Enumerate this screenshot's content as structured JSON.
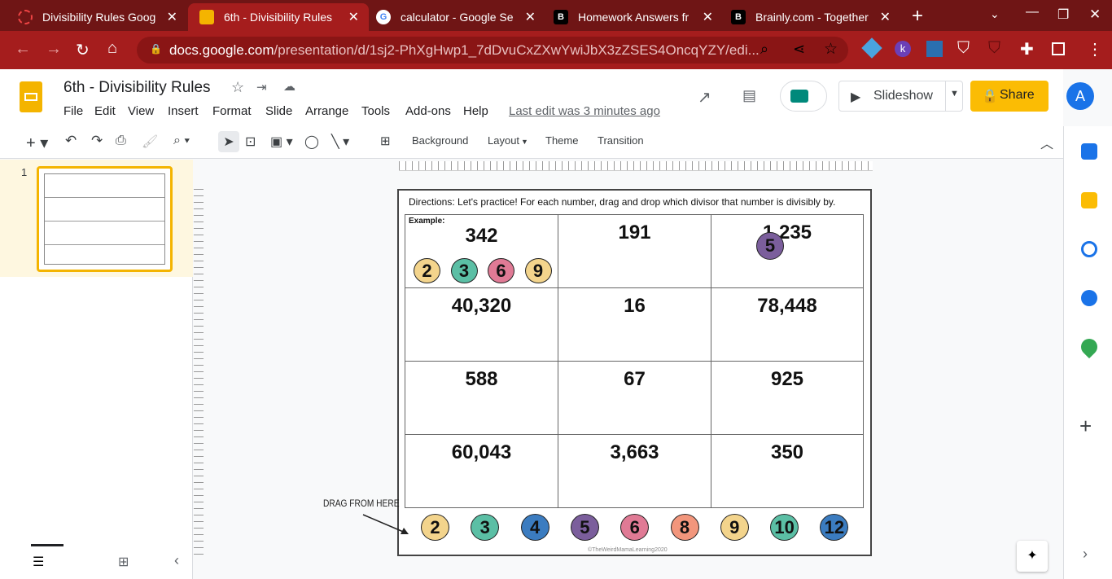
{
  "browser": {
    "tabs": [
      {
        "label": "Divisibility Rules Goog",
        "icon": "loading-icon"
      },
      {
        "label": "6th - Divisibility Rules",
        "icon": "slides-icon",
        "active": true
      },
      {
        "label": "calculator - Google Se",
        "icon": "google-icon"
      },
      {
        "label": "Homework Answers fr",
        "icon": "brainly-icon"
      },
      {
        "label": "Brainly.com - Together",
        "icon": "brainly-icon"
      }
    ],
    "url_host": "docs.google.com",
    "url_path": "/presentation/d/1sj2-PhXgHwp1_7dDvuCxZXwYwiJbX3zZSES4OncqYZY/edi..."
  },
  "doc": {
    "title": "6th - Divisibility Rules",
    "menu": [
      "File",
      "Edit",
      "View",
      "Insert",
      "Format",
      "Slide",
      "Arrange",
      "Tools",
      "Add-ons",
      "Help"
    ],
    "last_edit": "Last edit was 3 minutes ago",
    "slideshow": "Slideshow",
    "share": "Share",
    "avatar": "A"
  },
  "toolbar": {
    "background": "Background",
    "layout": "Layout",
    "theme": "Theme",
    "transition": "Transition"
  },
  "filmstrip": {
    "slide_number": "1"
  },
  "slide": {
    "directions": "Directions: Let's practice! For each number, drag and drop which divisor that number is divisibly by.",
    "example_label": "Example:",
    "numbers": [
      "342",
      "191",
      "1,235",
      "40,320",
      "16",
      "78,448",
      "588",
      "67",
      "925",
      "60,043",
      "3,663",
      "350"
    ],
    "example_chips": [
      {
        "n": "2",
        "color": "#f3d48c"
      },
      {
        "n": "3",
        "color": "#5bbfa5"
      },
      {
        "n": "6",
        "color": "#e07a95"
      },
      {
        "n": "9",
        "color": "#f3d48c"
      }
    ],
    "placed_chip": {
      "n": "5",
      "color": "#7b5e9c"
    },
    "drag_label": "DRAG FROM HERE",
    "bank": [
      {
        "n": "2",
        "color": "#f3d48c"
      },
      {
        "n": "3",
        "color": "#5bbfa5"
      },
      {
        "n": "4",
        "color": "#3b7cc0"
      },
      {
        "n": "5",
        "color": "#7b5e9c"
      },
      {
        "n": "6",
        "color": "#e07a95"
      },
      {
        "n": "8",
        "color": "#f2967c"
      },
      {
        "n": "9",
        "color": "#f3d48c"
      },
      {
        "n": "10",
        "color": "#5bbfa5"
      },
      {
        "n": "12",
        "color": "#3b7cc0"
      }
    ],
    "copyright": "©TheWeirdMamaLearning2020"
  }
}
